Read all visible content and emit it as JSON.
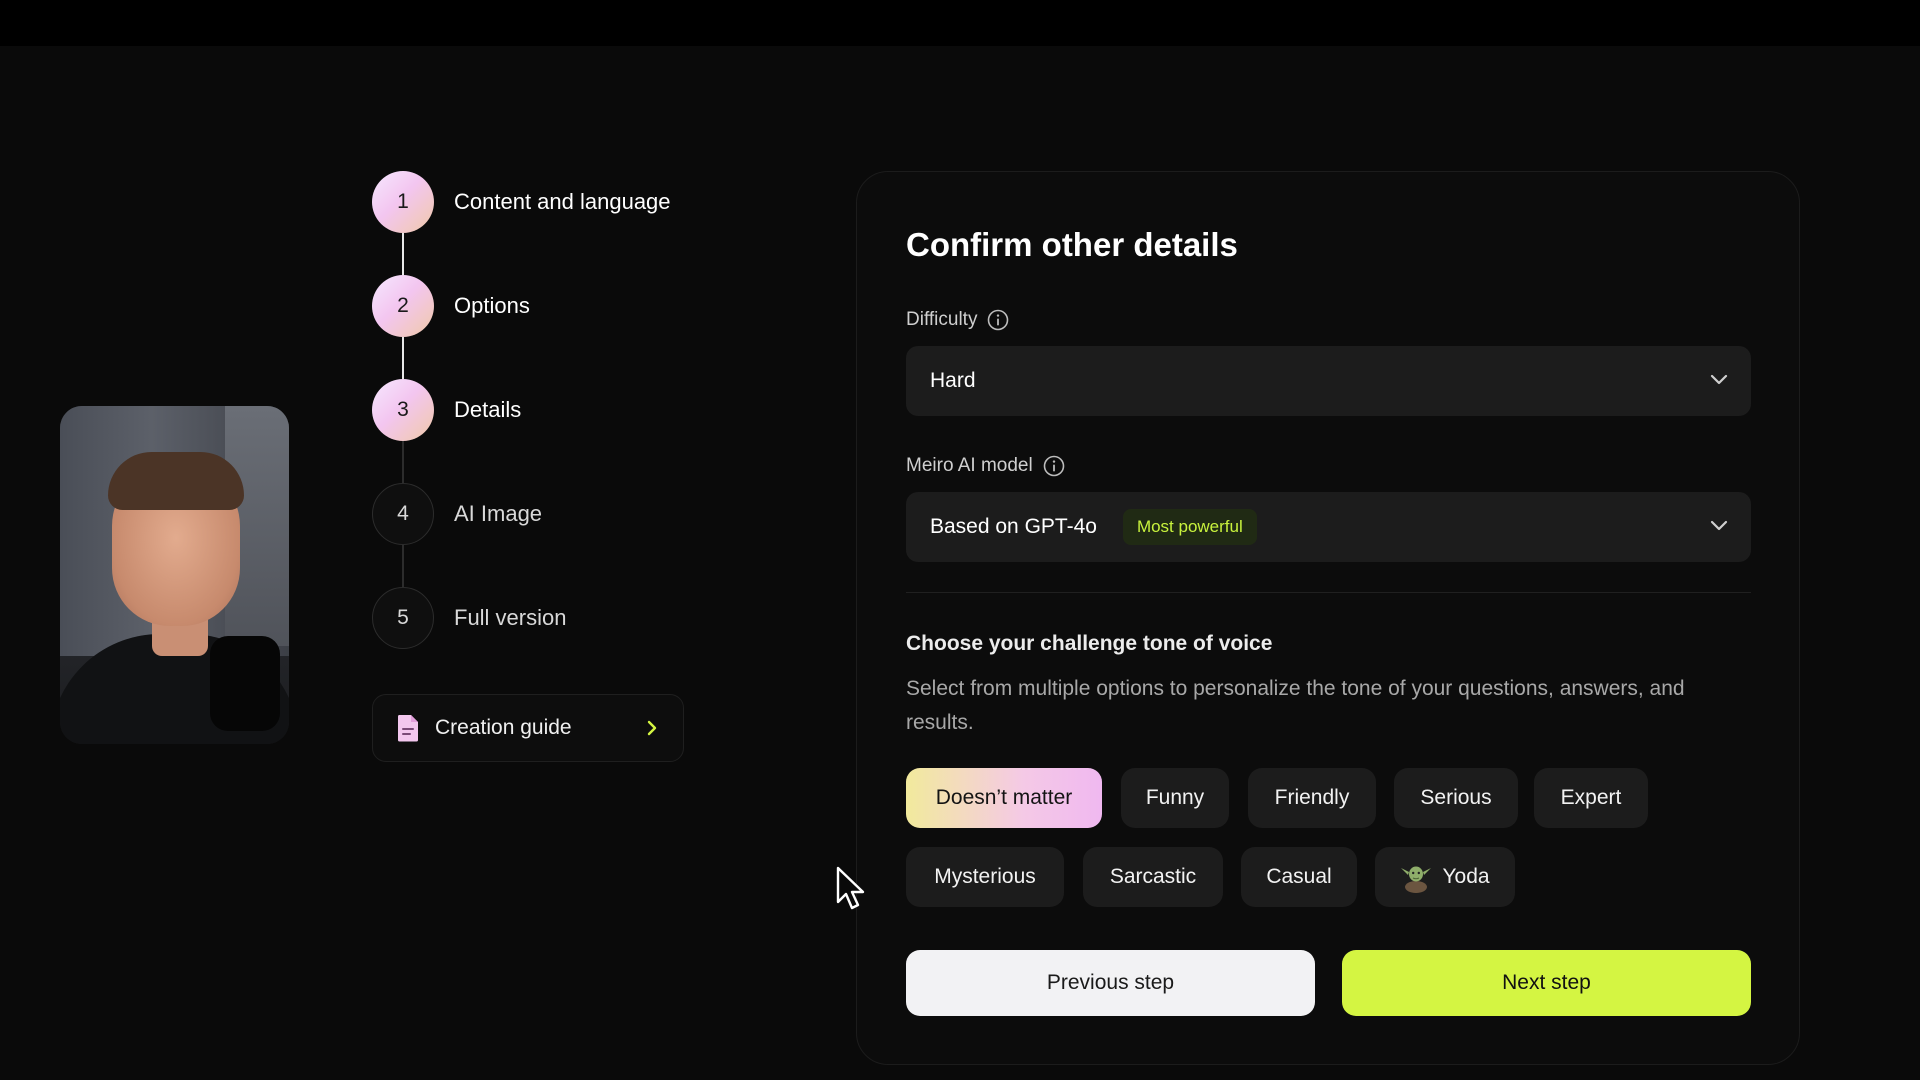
{
  "steps": [
    {
      "number": "1",
      "label": "Content and language",
      "state": "done"
    },
    {
      "number": "2",
      "label": "Options",
      "state": "done"
    },
    {
      "number": "3",
      "label": "Details",
      "state": "current"
    },
    {
      "number": "4",
      "label": "AI Image",
      "state": "upcoming"
    },
    {
      "number": "5",
      "label": "Full version",
      "state": "upcoming"
    }
  ],
  "guide": {
    "label": "Creation guide",
    "icon": "document-icon"
  },
  "panel": {
    "title": "Confirm other details",
    "difficulty": {
      "label": "Difficulty",
      "value": "Hard"
    },
    "model": {
      "label": "Meiro AI model",
      "value": "Based on GPT-4o",
      "badge": "Most powerful"
    },
    "tone": {
      "title": "Choose your challenge tone of voice",
      "description": "Select from multiple options to personalize the tone of your questions, answers, and results.",
      "options": [
        {
          "label": "Doesn’t matter",
          "selected": true
        },
        {
          "label": "Funny"
        },
        {
          "label": "Friendly"
        },
        {
          "label": "Serious"
        },
        {
          "label": "Expert"
        },
        {
          "label": "Mysterious"
        },
        {
          "label": "Sarcastic"
        },
        {
          "label": "Casual"
        },
        {
          "label": "Yoda",
          "icon": "yoda-icon"
        }
      ]
    },
    "buttons": {
      "previous": "Previous step",
      "next": "Next step"
    }
  },
  "colors": {
    "accent": "#d4f542",
    "badge_text": "#c8f23d",
    "background": "#0a0a0a"
  }
}
